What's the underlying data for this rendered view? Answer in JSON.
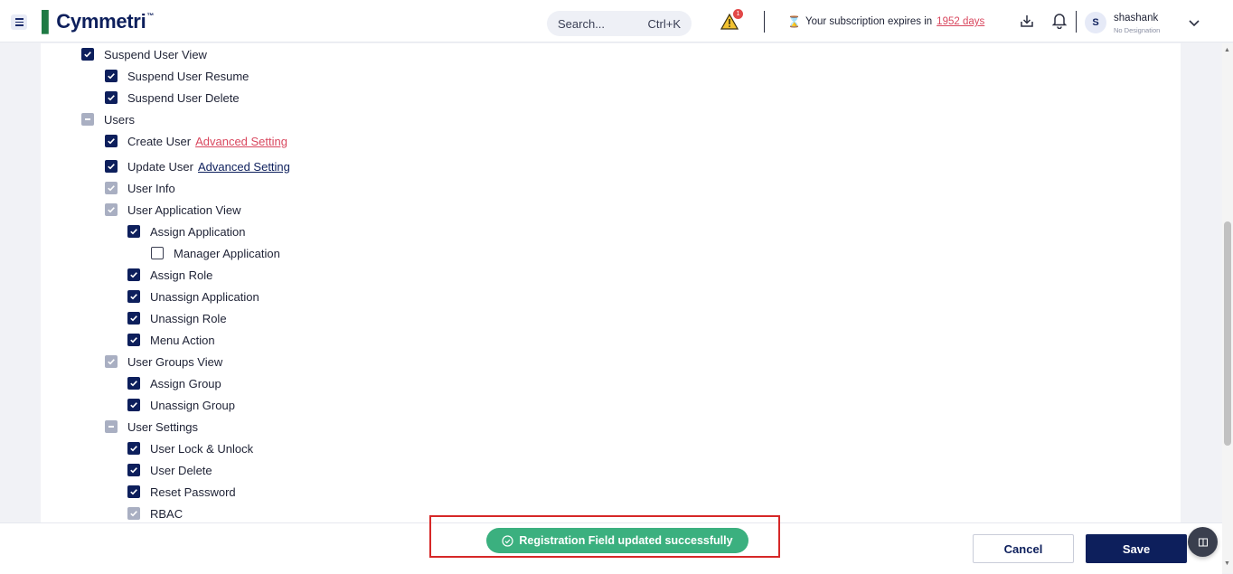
{
  "header": {
    "logo_text": "Cymmetri",
    "logo_tm": "™",
    "search_placeholder": "Search...",
    "search_shortcut": "Ctrl+K",
    "alert_count": "1",
    "subscription_text": "Your subscription expires in",
    "subscription_days": "1952 days",
    "user_initial": "S",
    "user_name": "shashank",
    "user_designation": "No Designation"
  },
  "tree": [
    {
      "label": "Suspend User View",
      "state": "checked"
    },
    {
      "label": "Suspend User Resume",
      "state": "checked"
    },
    {
      "label": "Suspend User Delete",
      "state": "checked"
    },
    {
      "label": "Users",
      "state": "partial"
    },
    {
      "label": "Create User",
      "state": "checked",
      "link": "Advanced Setting"
    },
    {
      "label": "Update User",
      "state": "checked",
      "link": "Advanced Setting"
    },
    {
      "label": "User Info",
      "state": "disabled"
    },
    {
      "label": "User Application View",
      "state": "disabled"
    },
    {
      "label": "Assign Application",
      "state": "checked"
    },
    {
      "label": "Manager Application",
      "state": "unchecked"
    },
    {
      "label": "Assign Role",
      "state": "checked"
    },
    {
      "label": "Unassign Application",
      "state": "checked"
    },
    {
      "label": "Unassign Role",
      "state": "checked"
    },
    {
      "label": "Menu Action",
      "state": "checked"
    },
    {
      "label": "User Groups View",
      "state": "disabled"
    },
    {
      "label": "Assign Group",
      "state": "checked"
    },
    {
      "label": "Unassign Group",
      "state": "checked"
    },
    {
      "label": "User Settings",
      "state": "partial"
    },
    {
      "label": "User Lock & Unlock",
      "state": "checked"
    },
    {
      "label": "User Delete",
      "state": "checked"
    },
    {
      "label": "Reset Password",
      "state": "checked"
    },
    {
      "label": "RBAC",
      "state": "disabled"
    }
  ],
  "toast": {
    "message": "Registration Field updated successfully"
  },
  "footer": {
    "cancel_label": "Cancel",
    "save_label": "Save"
  },
  "colors": {
    "primary": "#0d1f5c",
    "success": "#3bb07f",
    "link_red": "#d9485f",
    "highlight": "#d62828"
  }
}
